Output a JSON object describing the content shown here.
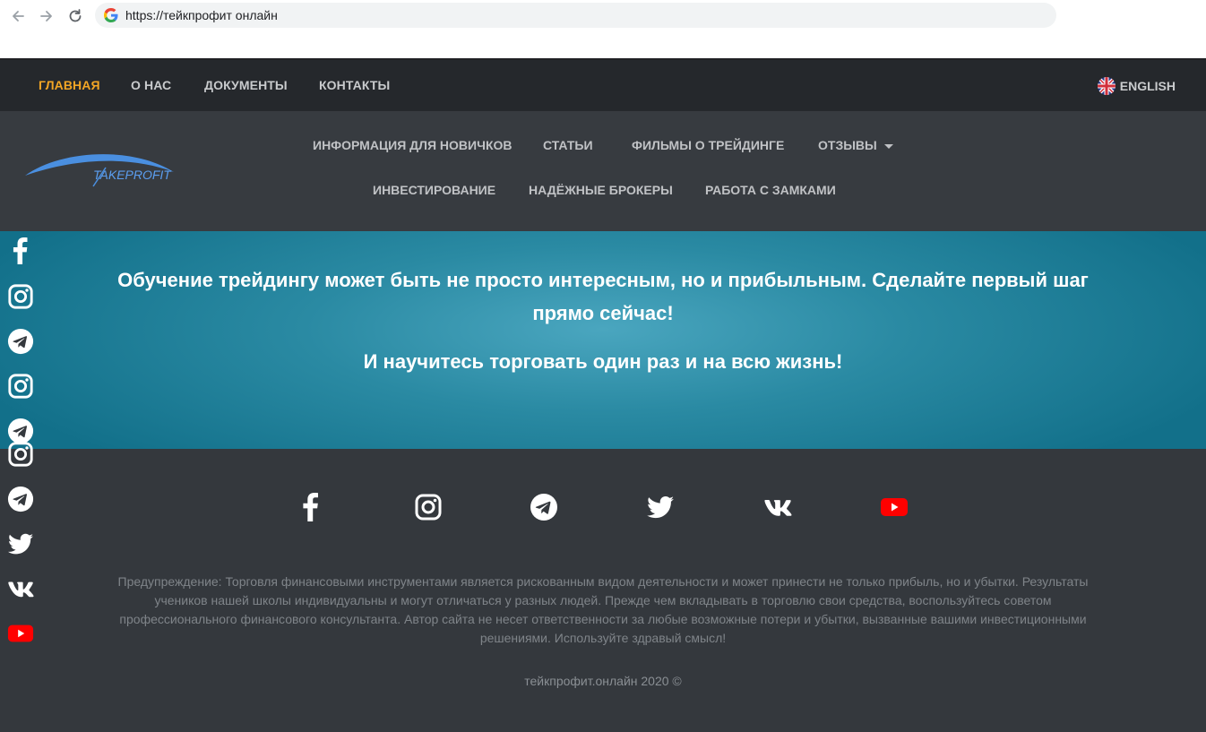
{
  "browser": {
    "url": "https://тейкпрофит онлайн"
  },
  "top_nav": {
    "items": [
      {
        "label": "ГЛАВНАЯ",
        "active": true
      },
      {
        "label": "О НАС",
        "active": false
      },
      {
        "label": "ДОКУМЕНТЫ",
        "active": false
      },
      {
        "label": "КОНТАКТЫ",
        "active": false
      }
    ],
    "language": "ENGLISH"
  },
  "logo": {
    "text": "TAKEPROFIT"
  },
  "main_menu": {
    "row1": [
      "ИНФОРМАЦИЯ ДЛЯ НОВИЧКОВ",
      "СТАТЬИ",
      "ФИЛЬМЫ О ТРЕЙДИНГЕ",
      "ОТЗЫВЫ"
    ],
    "row2": [
      "ИНВЕСТИРОВАНИЕ",
      "НАДЁЖНЫЕ БРОКЕРЫ",
      "РАБОТА С ЗАМКАМИ"
    ]
  },
  "hero": {
    "headline": "Обучение трейдингу может быть не просто интересным, но и прибыльным. Сделайте первый шаг прямо сейчас!",
    "subline": "И научитесь торговать один раз и на всю жизнь!"
  },
  "social": {
    "footer_icons": [
      "facebook-icon",
      "instagram-icon",
      "telegram-icon",
      "twitter-icon",
      "vk-icon",
      "youtube-icon"
    ],
    "side_icons": [
      "facebook-icon",
      "instagram-icon",
      "telegram-icon",
      "instagram-icon",
      "telegram-icon",
      "instagram-icon",
      "telegram-icon",
      "twitter-icon",
      "vk-icon",
      "youtube-icon"
    ]
  },
  "footer": {
    "warning": "Предупреждение: Торговля финансовыми инструментами является рискованным видом деятельности и может принести не только прибыль, но и убытки. Результаты учеников нашей школы индивидуальны и могут отличаться у разных людей. Прежде чем вкладывать в торговлю свои средства, воспользуйтесь советом профессионального финансового консультанта. Автор сайта не несет ответственности за любые возможные потери и убытки, вызванные вашими инвестиционными решениями. Используйте здравый смысл!",
    "copyright": "тейкпрофит.онлайн 2020 ©"
  },
  "colors": {
    "accent": "#f3a625",
    "top_nav_bg": "#25282c",
    "header_bg": "#373b40",
    "footer_bg": "#34383d",
    "hero_center": "#4aa6bf",
    "hero_edge": "#12708a",
    "youtube_red": "#ff0000"
  }
}
